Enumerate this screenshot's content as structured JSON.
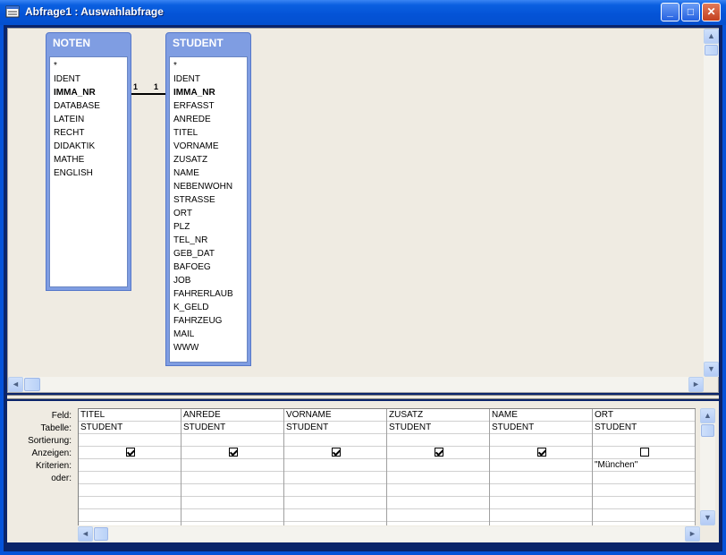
{
  "window": {
    "title": "Abfrage1 : Auswahlabfrage",
    "controls": {
      "minimize": "_",
      "maximize": "□",
      "close": "✕"
    }
  },
  "tables": [
    {
      "name": "NOTEN",
      "fields": [
        {
          "label": "*",
          "key": false
        },
        {
          "label": "IDENT",
          "key": false
        },
        {
          "label": "IMMA_NR",
          "key": true
        },
        {
          "label": "DATABASE",
          "key": false
        },
        {
          "label": "LATEIN",
          "key": false
        },
        {
          "label": "RECHT",
          "key": false
        },
        {
          "label": "DIDAKTIK",
          "key": false
        },
        {
          "label": "MATHE",
          "key": false
        },
        {
          "label": "ENGLISH",
          "key": false
        }
      ]
    },
    {
      "name": "STUDENT",
      "fields": [
        {
          "label": "*",
          "key": false
        },
        {
          "label": "IDENT",
          "key": false
        },
        {
          "label": "IMMA_NR",
          "key": true
        },
        {
          "label": "ERFASST",
          "key": false
        },
        {
          "label": "ANREDE",
          "key": false
        },
        {
          "label": "TITEL",
          "key": false
        },
        {
          "label": "VORNAME",
          "key": false
        },
        {
          "label": "ZUSATZ",
          "key": false
        },
        {
          "label": "NAME",
          "key": false
        },
        {
          "label": "NEBENWOHN",
          "key": false
        },
        {
          "label": "STRASSE",
          "key": false
        },
        {
          "label": "ORT",
          "key": false
        },
        {
          "label": "PLZ",
          "key": false
        },
        {
          "label": "TEL_NR",
          "key": false
        },
        {
          "label": "GEB_DAT",
          "key": false
        },
        {
          "label": "BAFOEG",
          "key": false
        },
        {
          "label": "JOB",
          "key": false
        },
        {
          "label": "FAHRERLAUB",
          "key": false
        },
        {
          "label": "K_GELD",
          "key": false
        },
        {
          "label": "FAHRZEUG",
          "key": false
        },
        {
          "label": "MAIL",
          "key": false
        },
        {
          "label": "WWW",
          "key": false
        }
      ]
    }
  ],
  "relationship": {
    "left_label": "1",
    "right_label": "1"
  },
  "grid": {
    "row_labels": [
      "Feld:",
      "Tabelle:",
      "Sortierung:",
      "Anzeigen:",
      "Kriterien:",
      "oder:"
    ],
    "columns": [
      {
        "field": "TITEL",
        "table": "STUDENT",
        "sort": "",
        "show": true,
        "criteria": "",
        "or": ""
      },
      {
        "field": "ANREDE",
        "table": "STUDENT",
        "sort": "",
        "show": true,
        "criteria": "",
        "or": ""
      },
      {
        "field": "VORNAME",
        "table": "STUDENT",
        "sort": "",
        "show": true,
        "criteria": "",
        "or": ""
      },
      {
        "field": "ZUSATZ",
        "table": "STUDENT",
        "sort": "",
        "show": true,
        "criteria": "",
        "or": ""
      },
      {
        "field": "NAME",
        "table": "STUDENT",
        "sort": "",
        "show": true,
        "criteria": "",
        "or": ""
      },
      {
        "field": "ORT",
        "table": "STUDENT",
        "sort": "",
        "show": false,
        "criteria": "\"München\"",
        "or": ""
      }
    ]
  },
  "icons": {
    "app": "query-window-icon",
    "scroll_up": "▲",
    "scroll_down": "▼",
    "scroll_left": "◄",
    "scroll_right": "►"
  }
}
